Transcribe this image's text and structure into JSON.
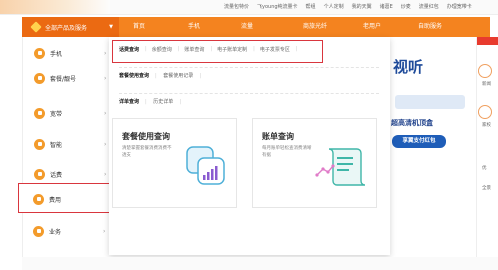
{
  "topbar": {
    "links": [
      "流量包特价",
      "飞young纯流量卡",
      "帮组",
      "个人定制",
      "我的天翼",
      "诸葛E",
      "炒麦",
      "流量红包",
      "办理宽带卡"
    ]
  },
  "nav": {
    "all_products": "全部产品及服务",
    "items": [
      "首页",
      "手机",
      "流量",
      "商旅光纤",
      "老用户",
      "自助服务"
    ]
  },
  "sidebar": {
    "items": [
      {
        "label": "手机"
      },
      {
        "label": "套餐/靓号"
      },
      {
        "label": "宽带"
      },
      {
        "label": "智能"
      },
      {
        "label": "话费"
      },
      {
        "label": "费用"
      },
      {
        "label": "业务"
      }
    ]
  },
  "panel": {
    "row1": {
      "items": [
        "话费查询",
        "余额查询",
        "账单查询",
        "电子账单定制",
        "电子发票专区"
      ]
    },
    "row2": {
      "items": [
        "套餐使用查询",
        "套餐使用记录"
      ]
    },
    "row3": {
      "items": [
        "详单查询",
        "历史详单"
      ]
    },
    "card1": {
      "title": "套餐使用查询",
      "desc": "清楚掌握套餐消费消费不透支"
    },
    "card2": {
      "title": "账单查询",
      "desc": "每月账单轻松查消费清晰有据"
    }
  },
  "hero": {
    "line1": "视听",
    "line2": "超高清机顶盒",
    "button": "享翼支付红包"
  },
  "rightcol": {
    "items": [
      "新闻",
      "家校",
      "优",
      "全景"
    ]
  }
}
